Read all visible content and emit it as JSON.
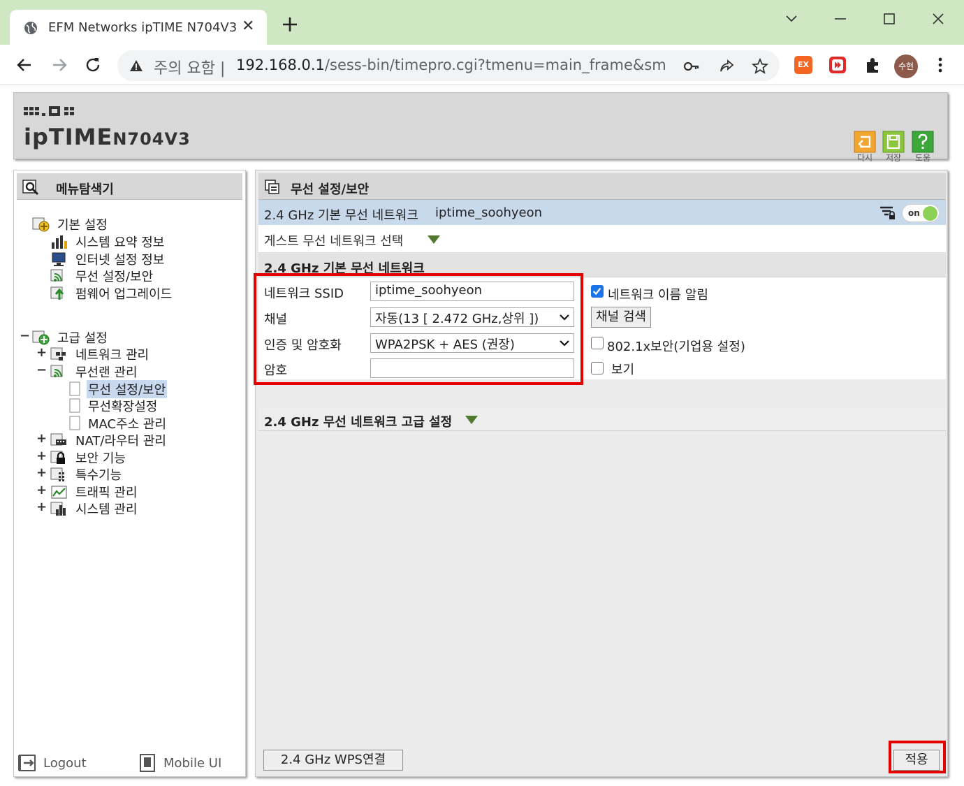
{
  "browser": {
    "tab_title": "EFM Networks ipTIME N704V3",
    "security_label": "주의 요함",
    "url_host": "192.168.0.1",
    "url_path": "/sess-bin/timepro.cgi?tmenu=main_frame&smenu...",
    "avatar_text": "수현",
    "ext1_label": "EX"
  },
  "header": {
    "logo_text": "ipTIME",
    "model": "N704V3",
    "buttons": [
      {
        "label": "다시",
        "icon": "undo-icon",
        "color": "#f0a732"
      },
      {
        "label": "저장",
        "icon": "save-icon",
        "color": "#8cc63f"
      },
      {
        "label": "도움",
        "icon": "help-icon",
        "color": "#3ca83c"
      }
    ]
  },
  "sidebar": {
    "title": "메뉴탐색기",
    "basic_group": "기본 설정",
    "basic_items": [
      "시스템 요약 정보",
      "인터넷 설정 정보",
      "무선 설정/보안",
      "펌웨어 업그레이드"
    ],
    "advanced_group": "고급 설정",
    "advanced_items": [
      {
        "label": "네트워크 관리",
        "toggle": "+"
      },
      {
        "label": "무선랜 관리",
        "toggle": "−"
      },
      {
        "label": "NAT/라우터 관리",
        "toggle": "+"
      },
      {
        "label": "보안 기능",
        "toggle": "+"
      },
      {
        "label": "특수기능",
        "toggle": "+"
      },
      {
        "label": "트래픽 관리",
        "toggle": "+"
      },
      {
        "label": "시스템 관리",
        "toggle": "+"
      }
    ],
    "wireless_sub": [
      "무선 설정/보안",
      "무선확장설정",
      "MAC주소 관리"
    ],
    "advanced_toggle": "−",
    "logout": "Logout",
    "mobile_ui": "Mobile UI"
  },
  "main": {
    "title": "무선 설정/보안",
    "network_label": "2.4 GHz 기본 무선 네트워크",
    "network_name": "iptime_soohyeon",
    "toggle_text": "on",
    "guest_label": "게스트 무선 네트워크 선택",
    "section_basic": "2.4 GHz 기본 무선 네트워크",
    "fields": {
      "ssid_label": "네트워크 SSID",
      "ssid_value": "iptime_soohyeon",
      "channel_label": "채널",
      "channel_value": "자동(13 [ 2.472 GHz,상위 ])",
      "auth_label": "인증 및 암호화",
      "auth_value": "WPA2PSK + AES (권장)",
      "password_label": "암호",
      "password_value": ""
    },
    "broadcast_label": "네트워크 이름 알림",
    "channel_scan_button": "채널 검색",
    "enterprise_label": "802.1x보안(기업용 설정)",
    "show_label": "보기",
    "section_advanced": "2.4 GHz 무선 네트워크 고급 설정",
    "wps_button": "2.4 GHz WPS연결",
    "apply_button": "적용"
  },
  "colors": {
    "highlight_box": "#e30000",
    "netbar_bg": "#c9d9ec",
    "toggle_on": "#8cd256"
  }
}
